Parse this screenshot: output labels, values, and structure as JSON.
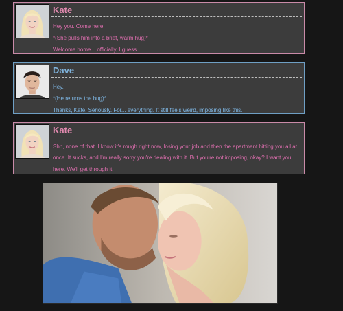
{
  "posts": [
    {
      "name": "Kate",
      "lines": [
        "Hey you. Come here.",
        "*(She pulls him into a brief, warm hug)*",
        "Welcome home... officially, I guess."
      ]
    },
    {
      "name": "Dave",
      "lines": [
        "Hey.",
        "*(He returns the hug)*",
        "Thanks, Kate. Seriously. For... everything. It still feels weird, imposing like this."
      ]
    },
    {
      "name": "Kate",
      "text": "Shh, none of that. I know it's rough right now, losing your job and then the apartment hitting you all at once. It sucks, and I'm really sorry you're dealing with it. But you're not imposing, okay? I want you here. We'll get through it."
    }
  ],
  "icons": {
    "kate_avatar": "blonde-woman-avatar-icon",
    "dave_avatar": "dark-haired-man-avatar-icon"
  },
  "colors": {
    "kate": "#e06fb0",
    "dave": "#7fb8e6",
    "background": "#161616",
    "panel": "#3c3c3c"
  }
}
